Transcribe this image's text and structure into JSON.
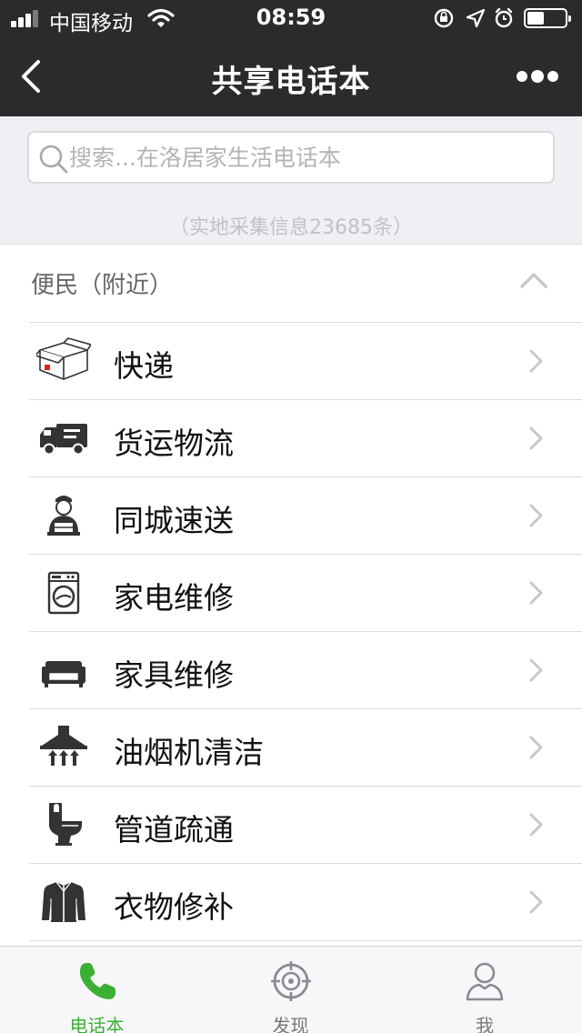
{
  "status_bar": {
    "carrier": "中国移动",
    "time": "08:59"
  },
  "nav": {
    "title": "共享电话本"
  },
  "search": {
    "placeholder": "搜索...在洛居家生活电话本"
  },
  "info_count": "（实地采集信息23685条）",
  "section": {
    "title": "便民（附近）"
  },
  "items": [
    {
      "label": "快递",
      "icon": "package-box-icon"
    },
    {
      "label": "货运物流",
      "icon": "truck-icon"
    },
    {
      "label": "同城速送",
      "icon": "courier-person-icon"
    },
    {
      "label": "家电维修",
      "icon": "washing-machine-icon"
    },
    {
      "label": "家具维修",
      "icon": "sofa-icon"
    },
    {
      "label": "油烟机清洁",
      "icon": "range-hood-icon"
    },
    {
      "label": "管道疏通",
      "icon": "toilet-icon"
    },
    {
      "label": "衣物修补",
      "icon": "jacket-icon"
    }
  ],
  "tabs": [
    {
      "label": "电话本",
      "icon": "phone-icon",
      "active": true
    },
    {
      "label": "发现",
      "icon": "target-icon",
      "active": false
    },
    {
      "label": "我",
      "icon": "user-icon",
      "active": false
    }
  ],
  "colors": {
    "nav_bg": "#2b2b2e",
    "accent_green": "#3cb034",
    "page_bg": "#efeff4"
  }
}
